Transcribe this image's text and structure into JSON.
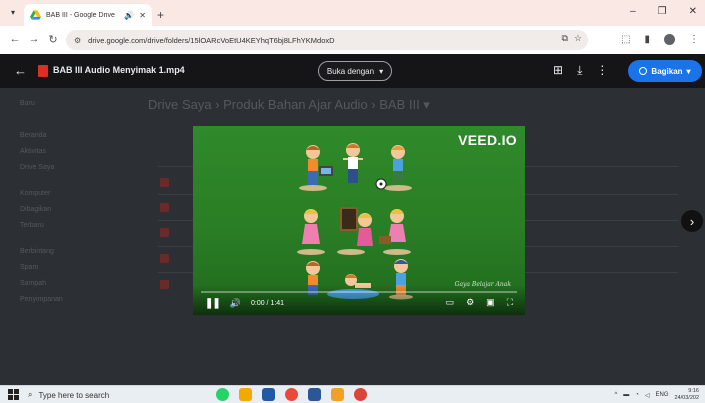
{
  "browser": {
    "tab_title": "BAB III - Google Drive",
    "url": "drive.google.com/drive/folders/15lOARcVoEtU4KEYhqT6bj8LFhYKMdoxD",
    "window_controls": [
      "–",
      "❐",
      "✕"
    ]
  },
  "drive_background": {
    "breadcrumb": "Drive Saya  ›  Produk Bahan Ajar Audio  ›  BAB III ▾",
    "sidebar": [
      "Baru",
      "Beranda",
      "Aktivitas",
      "Drive Saya",
      "Komputer",
      "Dibagikan",
      "Terbaru",
      "Berbintang",
      "Spam",
      "Sampah",
      "Penyimpanan"
    ]
  },
  "viewer": {
    "file_title": "BAB III Audio Menyimak 1.mp4",
    "open_with_label": "Buka dengan",
    "share_label": "Bagikan"
  },
  "video": {
    "brand": "VEED.IO",
    "watermark": "Gaya Belajar Anak",
    "time_display": "0:00 / 1:41",
    "progress_fraction": 0.0
  },
  "taskbar": {
    "search_placeholder": "Type here to search",
    "language": "ENG",
    "time": "9:16",
    "date": "24/03/202"
  }
}
